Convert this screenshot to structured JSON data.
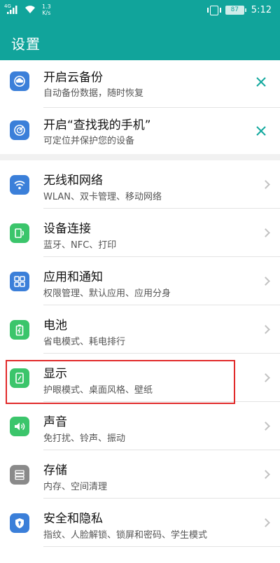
{
  "status": {
    "network_tag": "4G",
    "speed_value": "1.3",
    "speed_unit": "K/s",
    "battery": "87",
    "time": "5:12"
  },
  "header": {
    "title": "设置"
  },
  "suggestions": [
    {
      "title": "开启云备份",
      "subtitle": "自动备份数据，随时恢复",
      "icon": "cloud-backup-icon",
      "color": "#3b7fd9"
    },
    {
      "title": "开启“查找我的手机”",
      "subtitle": "可定位并保护您的设备",
      "icon": "find-phone-radar-icon",
      "color": "#3b7fd9"
    }
  ],
  "settings": [
    {
      "title": "无线和网络",
      "subtitle": "WLAN、双卡管理、移动网络",
      "icon": "wifi-icon",
      "color": "#3b7fd9"
    },
    {
      "title": "设备连接",
      "subtitle": "蓝牙、NFC、打印",
      "icon": "device-connection-icon",
      "color": "#3bc56b"
    },
    {
      "title": "应用和通知",
      "subtitle": "权限管理、默认应用、应用分身",
      "icon": "apps-grid-icon",
      "color": "#3b7fd9"
    },
    {
      "title": "电池",
      "subtitle": "省电模式、耗电排行",
      "icon": "battery-icon",
      "color": "#3bc56b"
    },
    {
      "title": "显示",
      "subtitle": "护眼模式、桌面风格、壁纸",
      "icon": "display-icon",
      "color": "#3bc56b"
    },
    {
      "title": "声音",
      "subtitle": "免打扰、铃声、振动",
      "icon": "speaker-icon",
      "color": "#3bc56b"
    },
    {
      "title": "存储",
      "subtitle": "内存、空间清理",
      "icon": "storage-icon",
      "color": "#8a8a8a"
    },
    {
      "title": "安全和隐私",
      "subtitle": "指纹、人脸解锁、锁屏和密码、学生模式",
      "icon": "shield-icon",
      "color": "#3b7fd9"
    }
  ]
}
